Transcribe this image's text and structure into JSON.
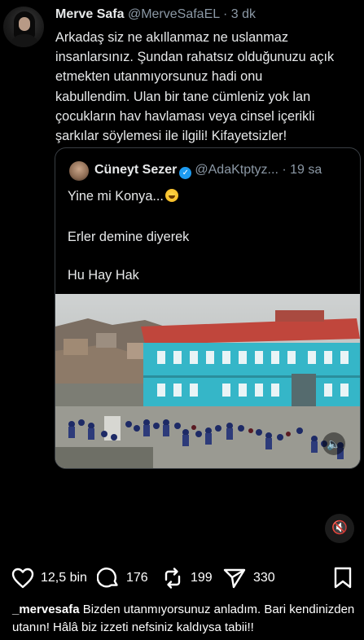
{
  "tweet": {
    "author_name": "Merve Safa",
    "author_handle": "@MerveSafaEL",
    "separator": " · ",
    "time": "3 dk",
    "text_lines": [
      "Arkadaş siz ne akıllanmaz ne uslanmaz",
      "insanlarsınız. Şundan rahatsız olduğunuzu açık",
      "etmekten utanmıyorsunuz hadi onu",
      "kabullendim. Ulan bir tane cümleniz yok lan",
      "çocukların hav havlaması veya cinsel içerikli",
      "şarkılar söylemesi ile ilgili!  Kifayetsizler!"
    ]
  },
  "quoted": {
    "author_name": "Cüneyt Sezer",
    "author_handle": "@AdaKtptyz...",
    "time": "· 19 sa",
    "line1": "Yine mi Konya...",
    "line2": "Erler demine diyerek",
    "line3": "Hu Hay Hak"
  },
  "actions": {
    "likes": "12,5 bin",
    "replies": "176",
    "reposts": "199",
    "shares": "330"
  },
  "caption": {
    "username": "_mervesafa",
    "text": " Bizden utanmıyorsunuz anladım. Bari kendinizden utanın! Hâlâ biz izzeti nefsiniz kaldıysa tabii!!"
  },
  "colors": {
    "background": "#000000",
    "text": "#e7e9ea",
    "muted": "#8b98a5",
    "verified": "#1d9bf0",
    "building": "#35b6c8",
    "roof": "#c0463c"
  },
  "icons": [
    "heart-icon",
    "comment-icon",
    "repost-icon",
    "share-icon",
    "bookmark-icon",
    "verified-icon",
    "volume-icon",
    "mute-icon"
  ]
}
